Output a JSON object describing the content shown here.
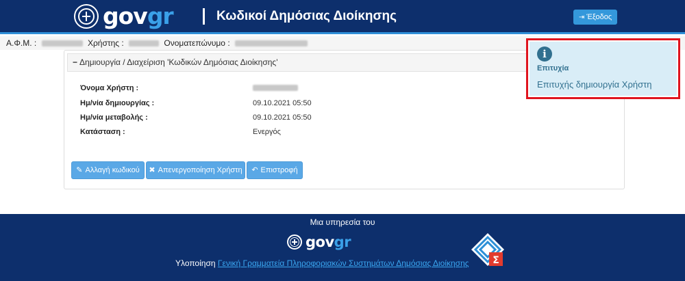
{
  "header": {
    "logo_main": "gov",
    "logo_accent": "gr",
    "title": "Κωδικοί Δημόσιας Διοίκησης",
    "logout_label": "Έξοδος",
    "logout_icon": "sign-out-icon"
  },
  "userbar": {
    "afm_label": "Α.Φ.Μ. :",
    "user_label": "Χρήστης :",
    "fullname_label": "Ονοματεπώνυμο :"
  },
  "panel": {
    "heading": "Δημιουργία / Διαχείριση 'Κωδικών Δημόσιας Διοίκησης'",
    "fields": [
      {
        "label": "Όνομα Χρήστη :",
        "value": ""
      },
      {
        "label": "Ημ/νία δημιουργίας :",
        "value": "09.10.2021 05:50"
      },
      {
        "label": "Ημ/νία μεταβολής :",
        "value": "09.10.2021 05:50"
      },
      {
        "label": "Κατάσταση :",
        "value": "Ενεργός"
      }
    ],
    "buttons": {
      "change_password": "Αλλαγή κωδικού",
      "deactivate_user": "Απενεργοποίηση Χρήστη",
      "back": "Επιστροφή"
    }
  },
  "toast": {
    "title": "Επιτυχία",
    "message": "Επιτυχής δημιουργία Χρήστη",
    "accent_color": "#31708f",
    "bg_color": "#d9edf7",
    "highlight_color": "#e0141e"
  },
  "footer": {
    "service_text": "Μια υπηρεσία του",
    "logo_main": "gov",
    "logo_accent": "gr",
    "impl_prefix": "Υλοποίηση",
    "impl_link": "Γενική Γραμματεία Πληροφοριακών Συστημάτων Δημόσιας Διοίκησης"
  },
  "colors": {
    "brand_navy": "#0d2f6c",
    "brand_blue": "#3498db",
    "button_blue": "#5aa8e6"
  }
}
